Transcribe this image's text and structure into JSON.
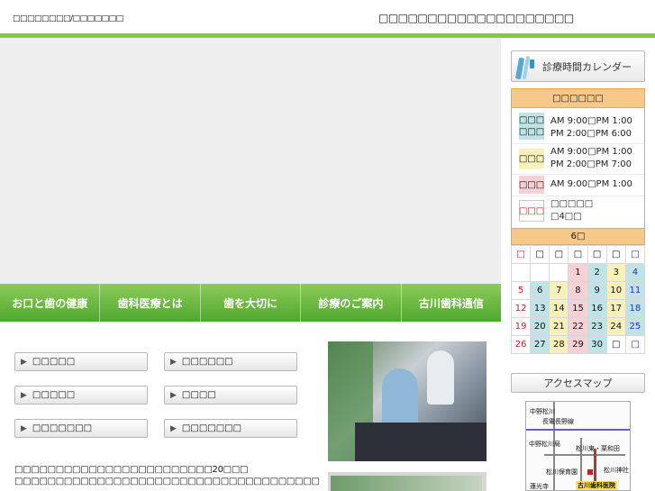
{
  "header": {
    "left_text": "□□□□□□□□/□□□□□□□",
    "right_text": "□□□□□□□□□□□□□□□□□□□□"
  },
  "nav": {
    "items": [
      "お口と歯の健康",
      "歯科医療とは",
      "歯を大切に",
      "診療のご案内",
      "古川歯科通信"
    ]
  },
  "sub_buttons": {
    "b1": "□□□□□",
    "b2": "□□□□□□",
    "b3": "□□□□□",
    "b4": "□□□□",
    "b5": "□□□□□□□",
    "b6": "□□□□□□□"
  },
  "notes": {
    "line1": "□□□□□□□□□□□□□□□□□□□□□□□□20□□□",
    "line2": "□□□□□□□□□□□□□□□□□□□□□□□□□□□□□□□□□□□□□"
  },
  "sidebar": {
    "calendar_button": "診療時間カレンダー",
    "access_button": "アクセスマップ",
    "hours_title": "□□□□□□",
    "hours": [
      {
        "day": "□□□\n□□□",
        "lines": [
          "AM 9:00□PM 1:00",
          "PM 2:00□PM 6:00"
        ],
        "color": "#bfe3e6"
      },
      {
        "day": "□□□",
        "lines": [
          "AM 9:00□PM 1:00",
          "PM 2:00□PM 7:00"
        ],
        "color": "#f7f0b8"
      },
      {
        "day": "□□□",
        "lines": [
          "AM 9:00□PM 1:00"
        ],
        "color": "#f7d0d6"
      },
      {
        "day": "□□□",
        "lines": [
          "□□□□□",
          "□4□□"
        ],
        "color": "#ffffff",
        "text_color": "#d21c1c"
      }
    ],
    "month_label": "6□",
    "weekdays": [
      "□",
      "□",
      "□",
      "□",
      "□",
      "□",
      "□"
    ],
    "weeks": [
      [
        "",
        "",
        "",
        "1",
        "2",
        "3",
        "4"
      ],
      [
        "5",
        "6",
        "7",
        "8",
        "9",
        "10",
        "11"
      ],
      [
        "12",
        "13",
        "14",
        "15",
        "16",
        "17",
        "18"
      ],
      [
        "19",
        "20",
        "21",
        "22",
        "23",
        "24",
        "25"
      ],
      [
        "26",
        "27",
        "28",
        "29",
        "30",
        "□",
        "□"
      ]
    ],
    "map_labels": [
      "中野松川",
      "長電長野線",
      "中野松川局",
      "松川東・栗和田",
      "松川保育園",
      "松川神社",
      "蓮光寺",
      "古川歯科医院"
    ]
  },
  "colors": {
    "green": "#8cc63f",
    "orange_header": "#f6c98a",
    "pink": "#f7d0d6",
    "teal": "#bfe3e6",
    "yellow": "#f7f0b8"
  }
}
